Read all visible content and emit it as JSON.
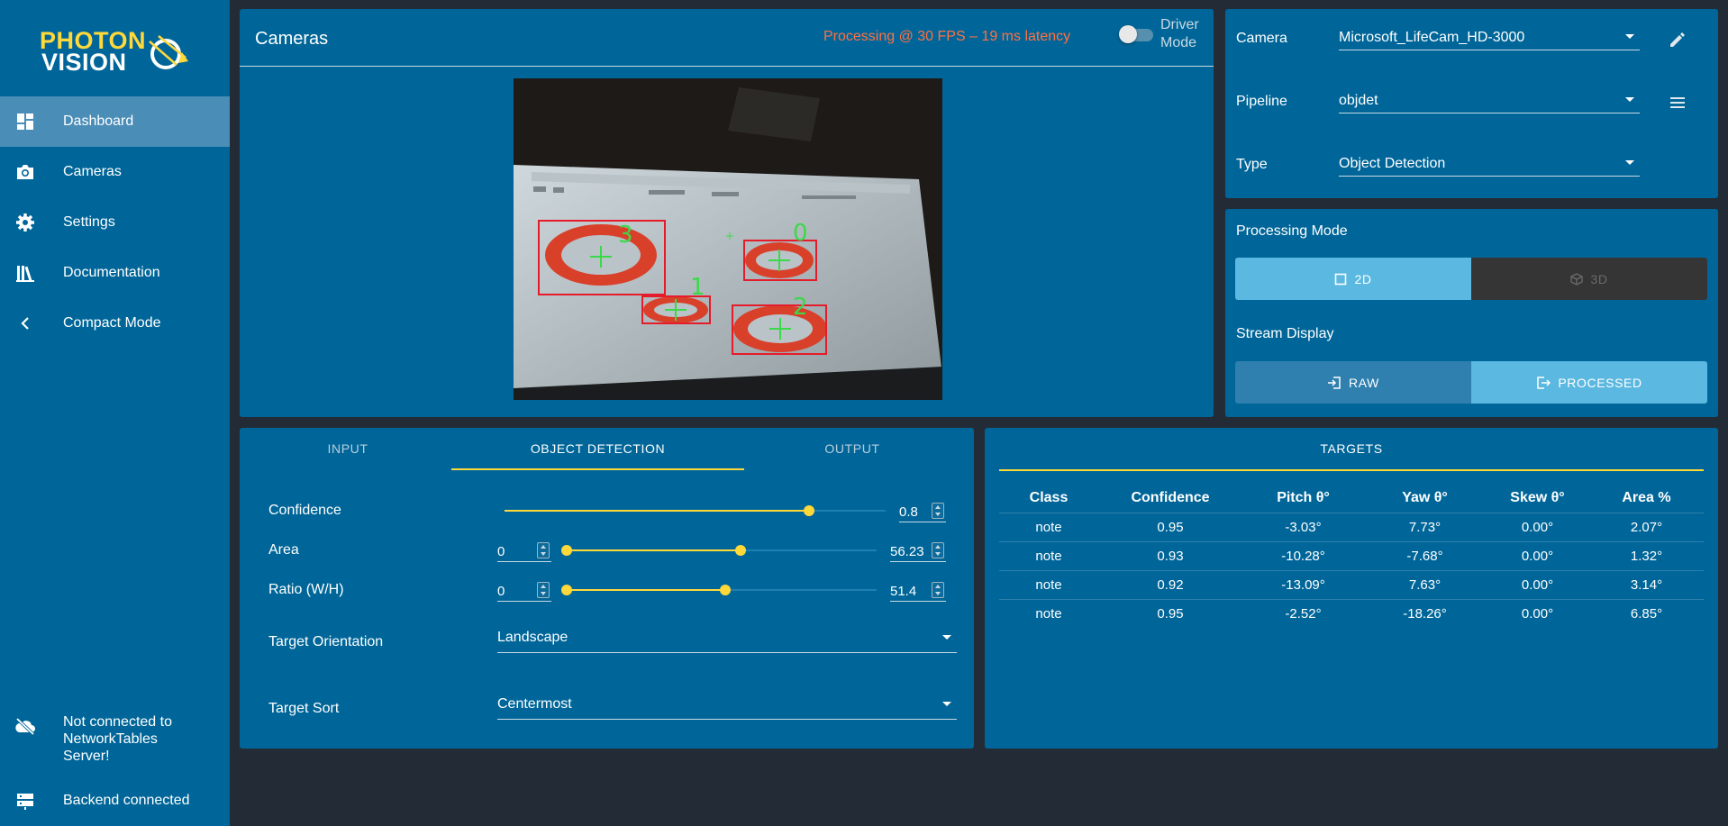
{
  "brand": {
    "line1": "PHOTON",
    "line2": "VISION"
  },
  "nav": [
    {
      "label": "Dashboard",
      "icon": "dashboard-icon",
      "active": true
    },
    {
      "label": "Cameras",
      "icon": "camera-icon"
    },
    {
      "label": "Settings",
      "icon": "gear-icon"
    },
    {
      "label": "Documentation",
      "icon": "books-icon"
    },
    {
      "label": "Compact Mode",
      "icon": "chevron-left-icon"
    }
  ],
  "status": {
    "networktables": "Not connected to NetworkTables Server!",
    "backend": "Backend connected"
  },
  "cameras_panel": {
    "title": "Cameras",
    "fps_text": "Processing @ 30 FPS – 19 ms latency",
    "driver_mode_label": "Driver Mode",
    "driver_mode_on": false,
    "detections": [
      {
        "label": "3"
      },
      {
        "label": "0"
      },
      {
        "label": "1"
      },
      {
        "label": "2"
      }
    ]
  },
  "selectors": {
    "camera": {
      "label": "Camera",
      "value": "Microsoft_LifeCam_HD-3000"
    },
    "pipeline": {
      "label": "Pipeline",
      "value": "objdet"
    },
    "type": {
      "label": "Type",
      "value": "Object Detection"
    }
  },
  "processing": {
    "mode_label": "Processing Mode",
    "mode_2d": "2D",
    "mode_3d": "3D",
    "stream_label": "Stream Display",
    "raw": "RAW",
    "processed": "PROCESSED",
    "selected_mode": "2D",
    "selected_stream": "PROCESSED"
  },
  "tabs": {
    "input": "INPUT",
    "object_detection": "OBJECT DETECTION",
    "output": "OUTPUT",
    "active": "OBJECT DETECTION"
  },
  "od": {
    "confidence": {
      "label": "Confidence",
      "value": "0.8",
      "fraction": 0.8
    },
    "area": {
      "label": "Area",
      "min": "0",
      "max": "56.23"
    },
    "ratio": {
      "label": "Ratio (W/H)",
      "min": "0",
      "max": "51.4"
    },
    "orientation": {
      "label": "Target Orientation",
      "value": "Landscape"
    },
    "sort": {
      "label": "Target Sort",
      "value": "Centermost"
    }
  },
  "targets": {
    "title": "TARGETS",
    "columns": [
      "Class",
      "Confidence",
      "Pitch θ°",
      "Yaw θ°",
      "Skew θ°",
      "Area %"
    ],
    "rows": [
      [
        "note",
        "0.95",
        "-3.03°",
        "7.73°",
        "0.00°",
        "2.07°"
      ],
      [
        "note",
        "0.93",
        "-10.28°",
        "-7.68°",
        "0.00°",
        "1.32°"
      ],
      [
        "note",
        "0.92",
        "-13.09°",
        "7.63°",
        "0.00°",
        "3.14°"
      ],
      [
        "note",
        "0.95",
        "-2.52°",
        "-18.26°",
        "0.00°",
        "6.85°"
      ]
    ]
  },
  "colors": {
    "panel": "#006699",
    "background": "#232c36",
    "accent_yellow": "#ffd83a",
    "fps_orange": "#ff7043",
    "selected_button": "#5bb8e0",
    "dark_button": "#353535"
  }
}
